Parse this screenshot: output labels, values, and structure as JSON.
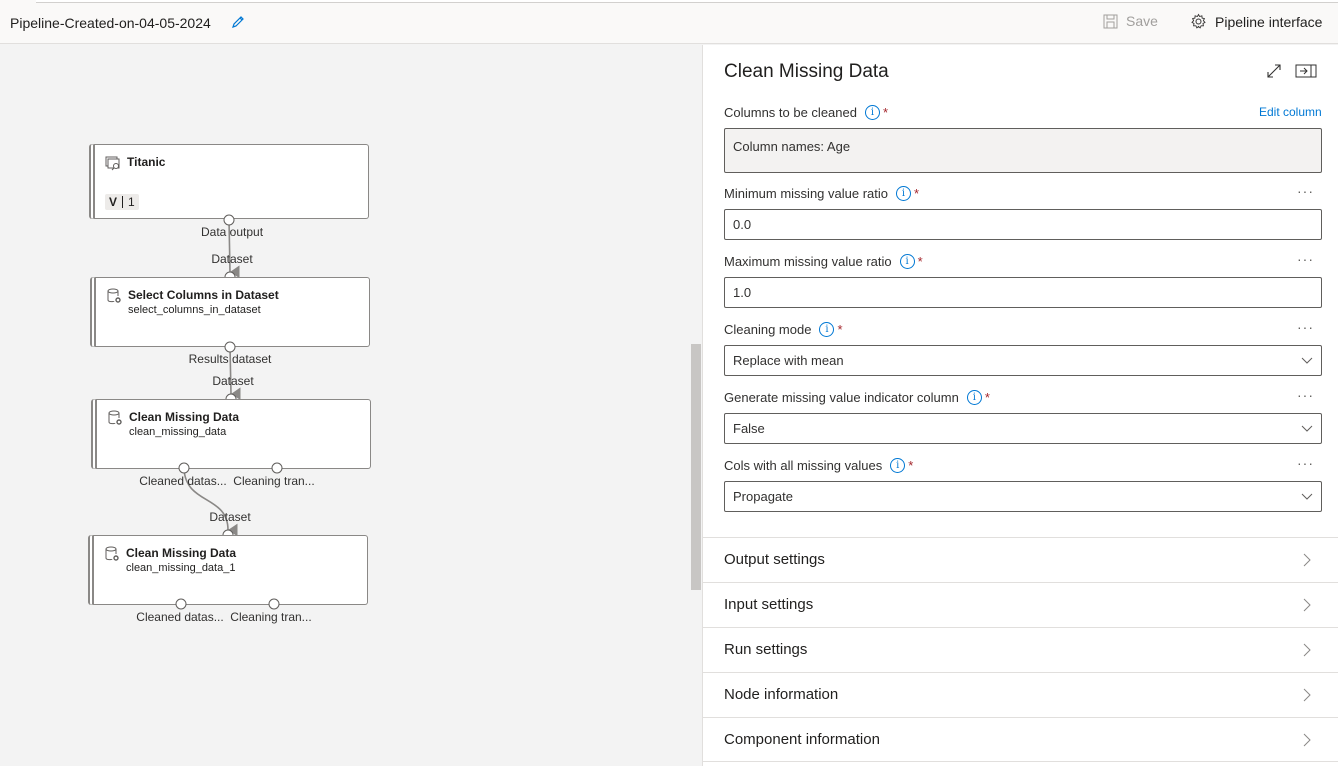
{
  "header": {
    "pipeline_title": "Pipeline-Created-on-04-05-2024",
    "save_label": "Save",
    "pipeline_interface_label": "Pipeline interface"
  },
  "canvas": {
    "nodes": [
      {
        "title": "Titanic",
        "subtitle": "",
        "version_label": "V",
        "version_value": "1",
        "icon": "dataset-icon"
      },
      {
        "title": "Select Columns in Dataset",
        "subtitle": "select_columns_in_dataset",
        "icon": "component-icon"
      },
      {
        "title": "Clean Missing Data",
        "subtitle": "clean_missing_data",
        "icon": "component-icon"
      },
      {
        "title": "Clean Missing Data",
        "subtitle": "clean_missing_data_1",
        "icon": "component-icon"
      }
    ],
    "port_labels": {
      "titanic_out": "Data output",
      "select_in": "Dataset",
      "select_out": "Results dataset",
      "clean1_in": "Dataset",
      "clean1_out1": "Cleaned datas...",
      "clean1_out2": "Cleaning tran...",
      "clean2_in": "Dataset",
      "clean2_out1": "Cleaned datas...",
      "clean2_out2": "Cleaning tran..."
    }
  },
  "panel": {
    "title": "Clean Missing Data",
    "edit_column_label": "Edit column",
    "fields": [
      {
        "label": "Columns to be cleaned",
        "required": "*",
        "value": "Column names: Age"
      },
      {
        "label": "Minimum missing value ratio",
        "required": "*",
        "value": "0.0"
      },
      {
        "label": "Maximum missing value ratio",
        "required": "*",
        "value": "1.0"
      },
      {
        "label": "Cleaning mode",
        "required": "*",
        "value": "Replace with mean"
      },
      {
        "label": "Generate missing value indicator column",
        "required": "*",
        "value": "False"
      },
      {
        "label": "Cols with all missing values",
        "required": "*",
        "value": "Propagate"
      }
    ],
    "more_label": "···",
    "sections": [
      {
        "label": "Output settings"
      },
      {
        "label": "Input settings"
      },
      {
        "label": "Run settings"
      },
      {
        "label": "Node information"
      },
      {
        "label": "Component information"
      }
    ]
  }
}
